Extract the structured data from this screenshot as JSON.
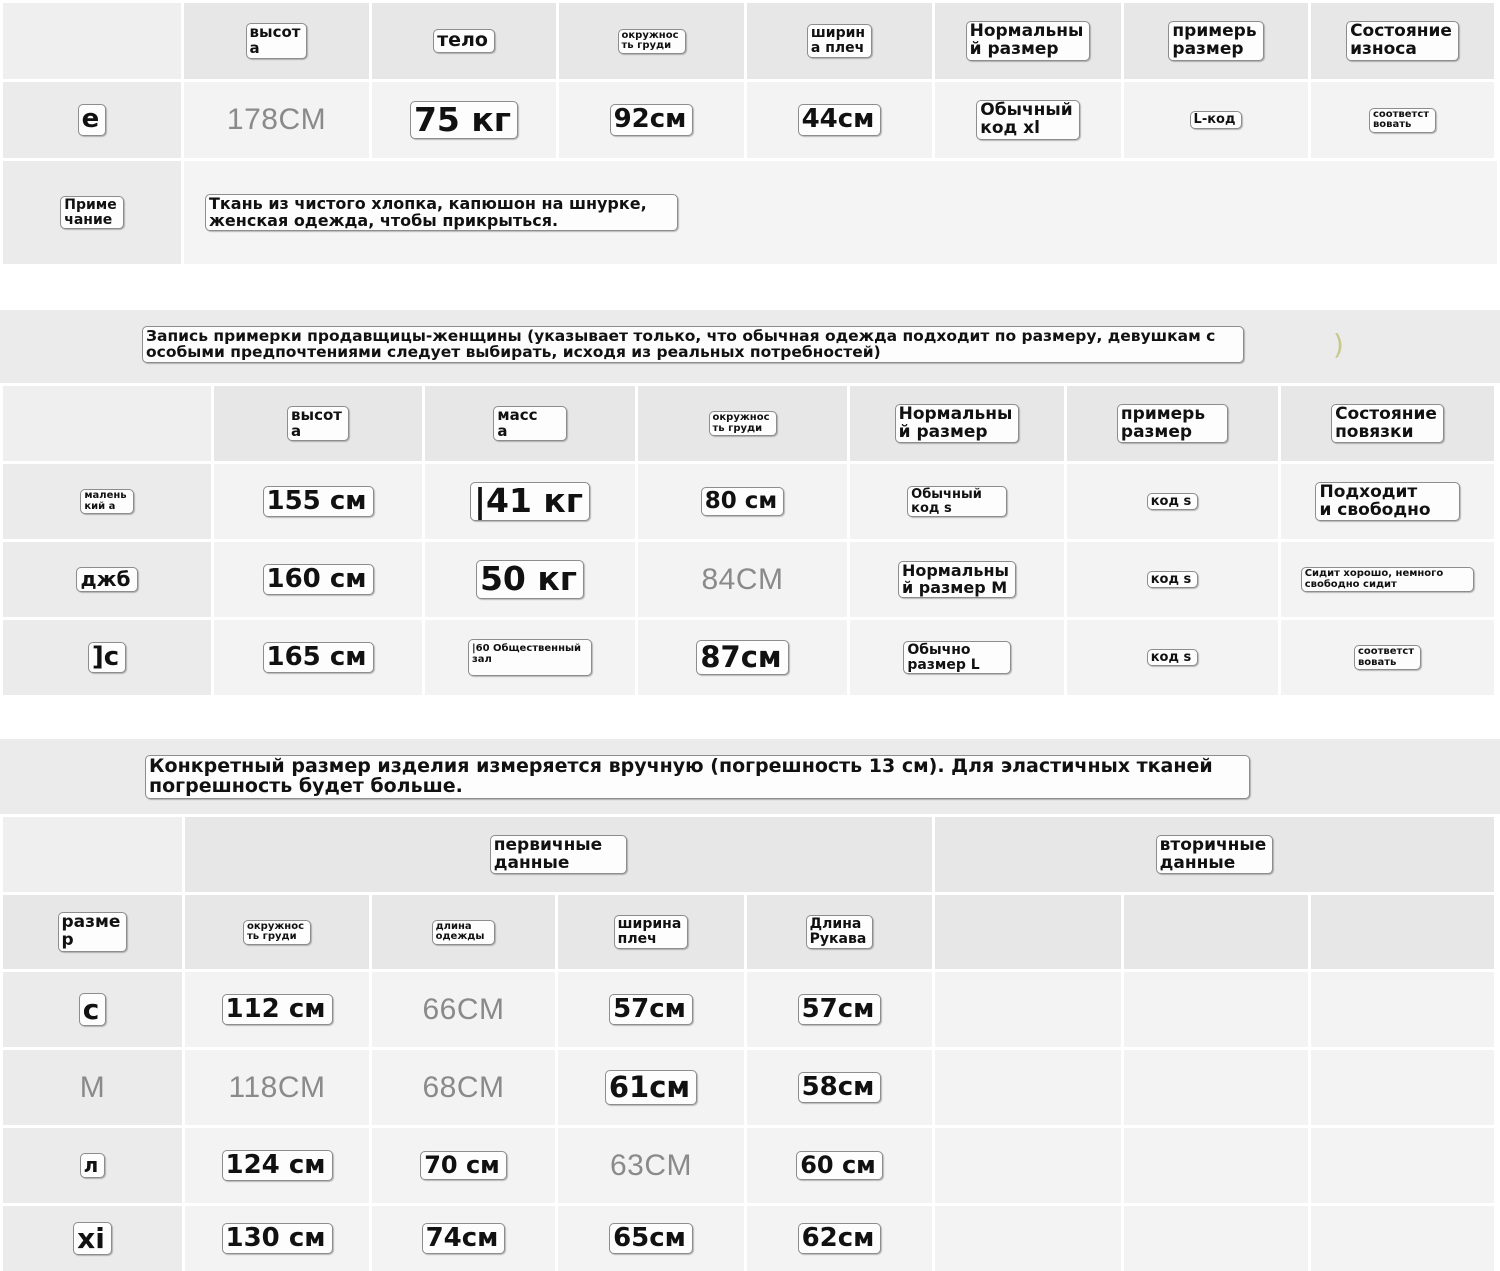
{
  "table1": {
    "headers": [
      "",
      "высот\nа",
      "тело",
      "окружнос\nть груди",
      "ширин\nа плеч",
      "Нормальны\nй размер",
      "примерь\nразмер",
      "Состояние\nизноса"
    ],
    "row": [
      "е",
      "178CM",
      "75 кг",
      "92см",
      "44см",
      "Обычный\nкод xl",
      "L-код",
      "соответст\nвовать"
    ],
    "note_label": "Приме\nчание",
    "note_text": "Ткань из чистого хлопка, капюшон на шнурке,\nженская одежда, чтобы прикрыться."
  },
  "table2": {
    "title": "Запись примерки продавщицы-женщины (указывает только, что обычная одежда подходит по размеру, девушкам с\nособыми предпочтениями следует выбирать, исходя из реальных потребностей)",
    "title_paren": ")",
    "headers": [
      "",
      "высот\nа",
      "масс\nа",
      "окружнос\nть груди",
      "Нормальны\nй размер",
      "примерь\nразмер",
      "Состояние\nповязки"
    ],
    "rows": [
      [
        "малень\nкий а",
        "155 см",
        "|41 кг",
        "80 см",
        "Обычный\nкод s",
        "код s",
        "Подходит\nи свободно"
      ],
      [
        "джб",
        "160 см",
        "50 кг",
        "84CM",
        "Нормальны\nй размер М",
        "код s",
        "Сидит хорошо, немного\nсвободно сидит"
      ],
      [
        "]с",
        "165 см",
        "|60 Общественный\nзал",
        "87см",
        "Обычно\nразмер L",
        "код s",
        "соответст\nвовать"
      ]
    ]
  },
  "table3": {
    "title": "Конкретный размер изделия измеряется вручную (погрешность 13 см). Для эластичных тканей\nпогрешность будет больше.",
    "group_primary": "первичные\nданные",
    "group_secondary": "вторичные\nданные",
    "headers": [
      "разме\nр",
      "окружнос\nть груди",
      "длина\nодежды",
      "ширина\nплеч",
      "Длина\nРукава",
      "",
      "",
      ""
    ],
    "rows": [
      [
        "с",
        "112 см",
        "66CM",
        "57см",
        "57см"
      ],
      [
        "M",
        "118CM",
        "68CM",
        "61см",
        "58см"
      ],
      [
        "л",
        "124 см",
        "70 см",
        "63CM",
        "60 см"
      ],
      [
        "xi",
        "130 см",
        "74см",
        "65см",
        "62см"
      ]
    ]
  }
}
